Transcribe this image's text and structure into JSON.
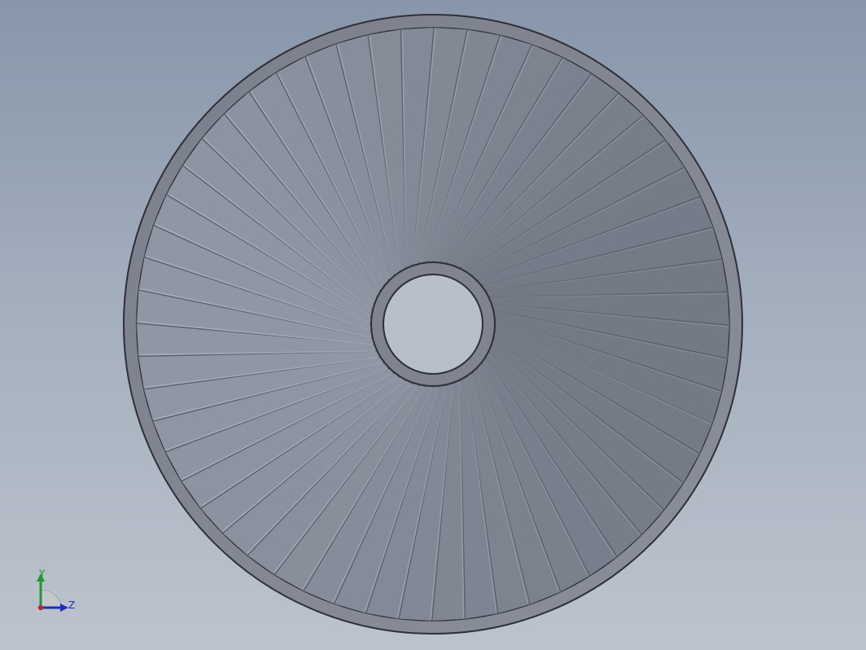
{
  "viewport": {
    "background_top": "#8796aa",
    "background_bottom": "#bcc3cd"
  },
  "model": {
    "type": "impeller-rotor",
    "blade_count": 56,
    "colors": {
      "rim_outer": "#7e828e",
      "rim_inner": "#858a96",
      "blade_face": "#7b808d",
      "blade_highlight": "#aeb4c2",
      "blade_edge": "#5b5f6a",
      "hub": "#80848f",
      "bore": "#b8bfc9",
      "outline": "#2e3038"
    }
  },
  "triad": {
    "y_label": "Y",
    "z_label": "Z",
    "y_color": "#1f9a2a",
    "z_color": "#1c2ec0",
    "x_color": "#c0232b"
  }
}
